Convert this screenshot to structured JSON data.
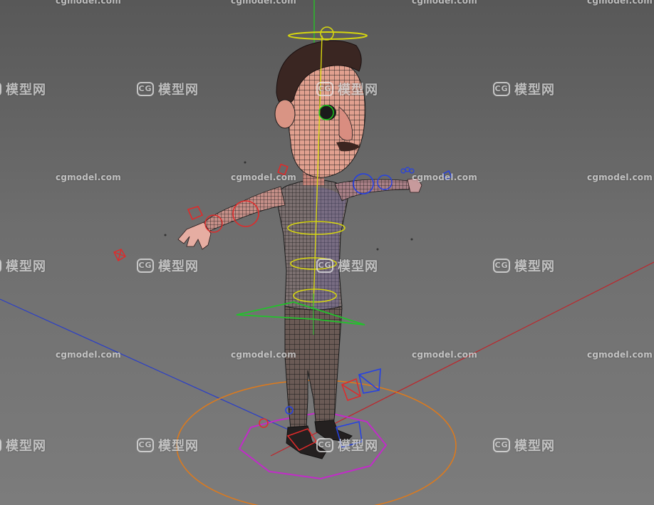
{
  "viewport": {
    "title": "3D viewport - rigged cartoon character, wireframe on shaded",
    "background_top": "#585858",
    "background_bottom": "#7c7c7c"
  },
  "axes": {
    "x_color": "#c0242a",
    "y_color": "#1fd21f",
    "z_color": "#2a3ec8"
  },
  "rig_colors": {
    "root_circle": "#e07a1a",
    "hip_polygon": "#c22bc9",
    "spine_controls": "#d6d60f",
    "cog_triangle": "#22c22b",
    "left_side": "#e02a2a",
    "right_side": "#2440e6"
  },
  "watermarks": {
    "en": "cgmodel.com",
    "cn": "模型网",
    "cn_logo": "CG"
  }
}
